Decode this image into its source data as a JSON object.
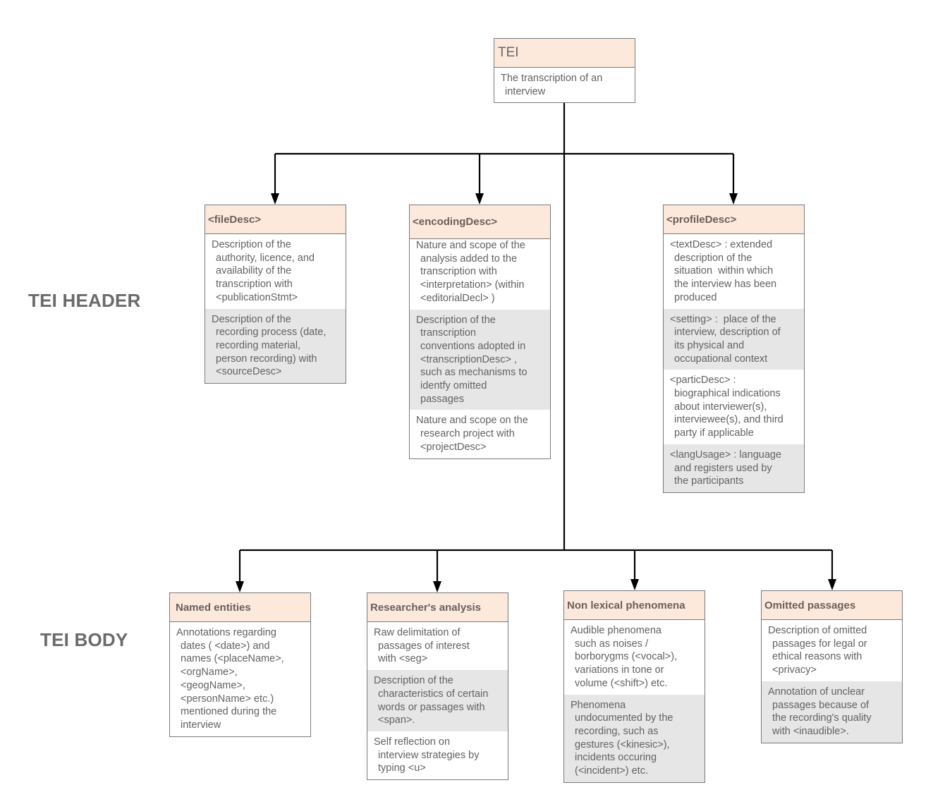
{
  "diagram": {
    "root": {
      "title": "TEI",
      "sections": [
        {
          "lines": [
            "The transcription of an",
            "interview"
          ],
          "shaded": false
        }
      ]
    },
    "labels": {
      "header": "TEI HEADER",
      "body": "TEI BODY"
    },
    "header_nodes": [
      {
        "id": "fileDesc",
        "title": "<fileDesc>",
        "sections": [
          {
            "lines": [
              "Description of the",
              "authority, licence, and",
              "availability of the",
              "transcription with",
              "<publicationStmt>"
            ],
            "shaded": false
          },
          {
            "lines": [
              "Description of the",
              "recording process (date,",
              "recording material,",
              "person recording) with",
              "<sourceDesc>"
            ],
            "shaded": true
          }
        ]
      },
      {
        "id": "encodingDesc",
        "title": "<encodingDesc>",
        "sections": [
          {
            "lines": [
              "Nature and scope of the",
              "analysis added to the",
              "transcription with",
              "<interpretation> (within",
              "<editorialDecl> )"
            ],
            "shaded": false
          },
          {
            "lines": [
              "Description of the",
              "transcription",
              "conventions adopted in",
              "<transcriptionDesc> ,",
              "such as mechanisms to",
              "identfy omitted",
              "passages"
            ],
            "shaded": true
          },
          {
            "lines": [
              "Nature and scope on the",
              "research project with",
              "<projectDesc>"
            ],
            "shaded": false
          }
        ]
      },
      {
        "id": "profileDesc",
        "title": "<profileDesc>",
        "sections": [
          {
            "lines": [
              "<textDesc> : extended",
              "description of the",
              "situation  within which",
              "the interview has been",
              "produced"
            ],
            "shaded": false
          },
          {
            "lines": [
              "<setting> :  place of the",
              "interview, description of",
              "its physical and",
              "occupational context"
            ],
            "shaded": true
          },
          {
            "lines": [
              "<particDesc> :",
              "biographical indications",
              "about interviewer(s),",
              "interviewee(s), and third",
              "party if applicable"
            ],
            "shaded": false
          },
          {
            "lines": [
              "<langUsage> : language",
              "and registers used by",
              "the participants"
            ],
            "shaded": true
          }
        ]
      }
    ],
    "body_nodes": [
      {
        "id": "named-entities",
        "title": "Named entities",
        "sections": [
          {
            "lines": [
              "Annotations regarding",
              "dates ( <date>) and",
              "names (<placeName>,",
              "<orgName>,",
              "<geogName>,",
              "<personName> etc.)",
              "mentioned during the",
              "interview"
            ],
            "shaded": false
          }
        ]
      },
      {
        "id": "researchers-analysis",
        "title": "Researcher's analysis",
        "sections": [
          {
            "lines": [
              "Raw delimitation of",
              "passages of interest",
              "with <seg>"
            ],
            "shaded": false
          },
          {
            "lines": [
              "Description of the",
              "characteristics of certain",
              "words or passages with",
              "<span>."
            ],
            "shaded": true
          },
          {
            "lines": [
              "Self reflection on",
              "interview strategies by",
              "typing <u>"
            ],
            "shaded": false
          }
        ]
      },
      {
        "id": "non-lexical-phenomena",
        "title": "Non lexical phenomena",
        "sections": [
          {
            "lines": [
              "Audible phenomena",
              "such as noises /",
              "borborygms (<vocal>),",
              "variations in tone or",
              "volume (<shift>) etc."
            ],
            "shaded": false
          },
          {
            "lines": [
              "Phenomena",
              "undocumented by the",
              "recording, such as",
              "gestures (<kinesic>),",
              "incidents occuring",
              "(<incident>) etc."
            ],
            "shaded": true
          }
        ]
      },
      {
        "id": "omitted-passages",
        "title": "Omitted passages",
        "sections": [
          {
            "lines": [
              "Description of omitted",
              "passages for legal or",
              "ethical reasons with",
              "<privacy>"
            ],
            "shaded": false
          },
          {
            "lines": [
              "Annotation of unclear",
              "passages because of",
              "the recording's quality",
              "with <inaudible>."
            ],
            "shaded": true
          }
        ]
      }
    ],
    "colors": {
      "header_fill": "#fde9dc",
      "shaded_fill": "#e6e6e6",
      "border": "#7a7a7a",
      "connector": "#000000"
    }
  }
}
